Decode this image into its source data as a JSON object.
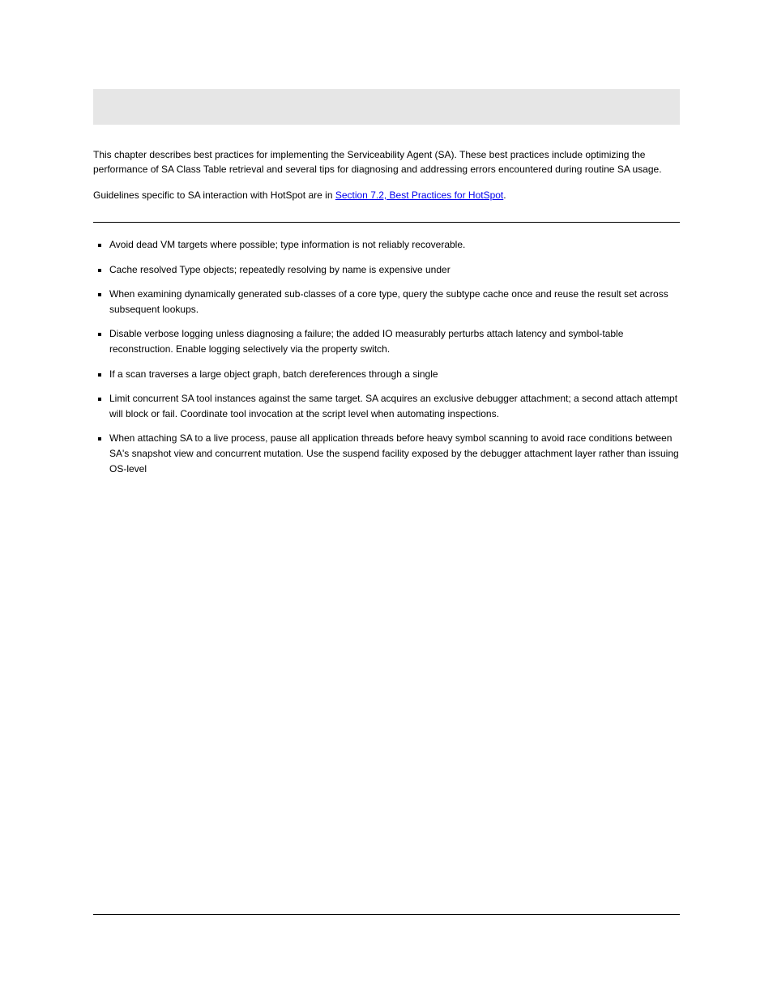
{
  "banner": "",
  "paragraphs": {
    "p1": "This chapter describes best practices for implementing the Serviceability Agent (SA). These best practices include optimizing the performance of SA Class Table retrieval and several tips for diagnosing and addressing errors encountered during routine SA usage.",
    "p2_prefix": "Guidelines specific to SA interaction with HotSpot are in ",
    "p2_link_text": "Section 7.2, Best Practices for HotSpot",
    "p2_suffix": "."
  },
  "list_items": [
    "Avoid dead VM targets where possible; type information is not reliably recoverable.",
    "Cache resolved Type objects; repeatedly resolving by name is expensive under ",
    "When examining dynamically generated sub-classes of a core type, query the subtype cache once and reuse the result set across subsequent lookups.",
    "Disable verbose logging unless diagnosing a failure; the added IO measurably perturbs attach latency and symbol-table reconstruction. Enable logging selectively via the property switch.",
    "If a scan traverses a large object graph, batch dereferences through a single ",
    "Limit concurrent SA tool instances against the same target. SA acquires an exclusive debugger attachment; a second attach attempt will block or fail. Coordinate tool invocation at the script level when automating inspections.",
    "When attaching SA to a live process, pause all application threads before heavy symbol scanning to avoid race conditions between SA's snapshot view and concurrent mutation. Use the suspend facility exposed by the debugger attachment layer rather than issuing OS-level "
  ]
}
